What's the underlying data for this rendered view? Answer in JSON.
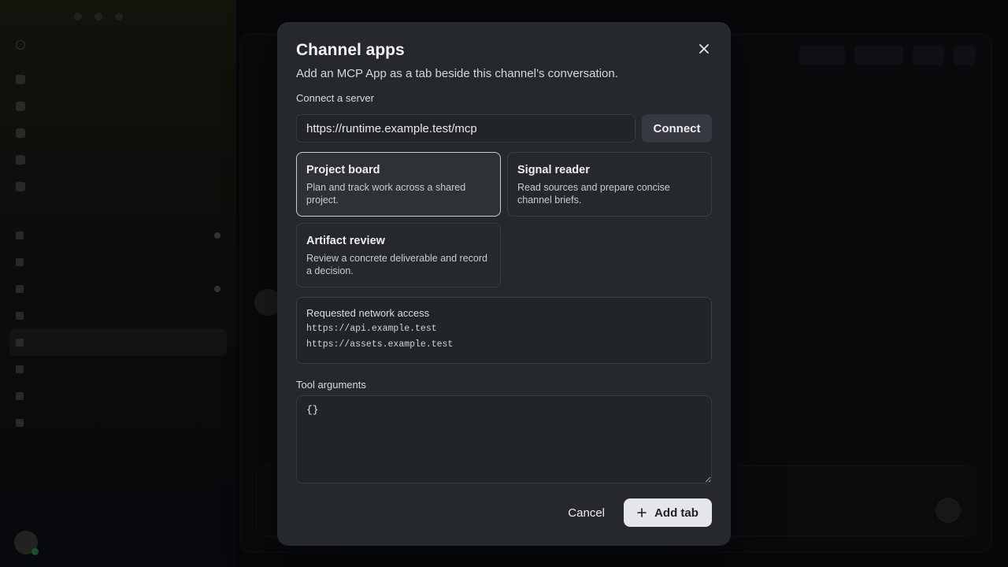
{
  "modal": {
    "title": "Channel apps",
    "subtitle": "Add an MCP App as a tab beside this channel’s conversation.",
    "server_label": "Connect a server",
    "server_url": "https://runtime.example.test/mcp",
    "connect_label": "Connect",
    "apps": [
      {
        "title": "Project board",
        "description": "Plan and track work across a shared project.",
        "selected": true
      },
      {
        "title": "Signal reader",
        "description": "Read sources and prepare concise channel briefs.",
        "selected": false
      },
      {
        "title": "Artifact review",
        "description": "Review a concrete deliverable and record a decision.",
        "selected": false
      }
    ],
    "network": {
      "title": "Requested network access",
      "domains": [
        "https://api.example.test",
        "https://assets.example.test"
      ]
    },
    "args_label": "Tool arguments",
    "args_value": "{}",
    "cancel_label": "Cancel",
    "add_label": "Add tab"
  },
  "colors": {
    "modal_bg": "#25282c",
    "selected_border": "#c9ccd0",
    "primary_button": "#e4e6e9"
  },
  "icons": {
    "close": "close-icon",
    "add": "plus-icon"
  }
}
